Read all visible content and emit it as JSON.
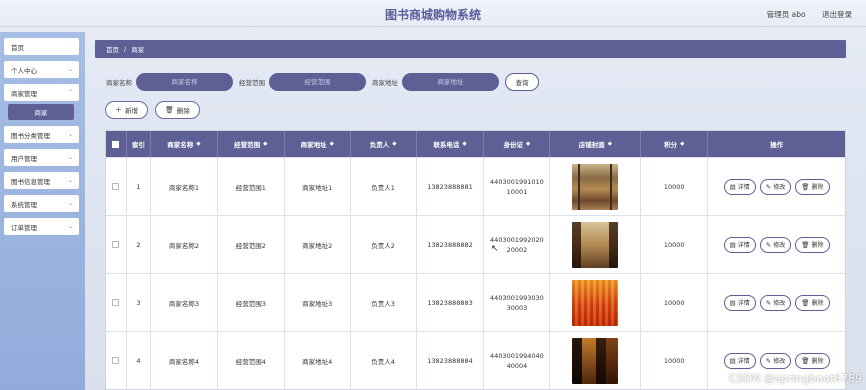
{
  "header": {
    "title": "图书商城购物系统",
    "user_label": "管理员 abo",
    "logout_label": "退出登录"
  },
  "sidebar": {
    "items": [
      {
        "label": "首页",
        "has_chevron": false
      },
      {
        "label": "个人中心",
        "has_chevron": true
      },
      {
        "label": "商家管理",
        "has_chevron": true
      },
      {
        "label": "图书分类管理",
        "has_chevron": true
      },
      {
        "label": "用户管理",
        "has_chevron": true
      },
      {
        "label": "图书信息管理",
        "has_chevron": true
      },
      {
        "label": "系统管理",
        "has_chevron": true
      },
      {
        "label": "订单管理",
        "has_chevron": true
      }
    ],
    "active_sub": "商家"
  },
  "breadcrumb": {
    "home": "首页",
    "separator": "/",
    "current": "商家"
  },
  "search": {
    "name_label": "商家名称",
    "name_placeholder": "商家名称",
    "scope_label": "经营范围",
    "scope_placeholder": "经营范围",
    "address_label": "商家地址",
    "address_placeholder": "商家地址",
    "button": "查询"
  },
  "toolbar": {
    "add": "新增",
    "delete": "删除"
  },
  "table": {
    "headers": {
      "index": "索引",
      "name": "商家名称",
      "scope": "经营范围",
      "address": "商家地址",
      "owner": "负责人",
      "phone": "联系电话",
      "idcard": "身份证",
      "image": "店铺封面",
      "points": "积分",
      "ops": "操作"
    },
    "rows": [
      {
        "index": "1",
        "name": "商家名称1",
        "scope": "经营范围1",
        "address": "商家地址1",
        "owner": "负责人1",
        "phone": "13823888881",
        "idcard": "440300199101010001",
        "points": "10000"
      },
      {
        "index": "2",
        "name": "商家名称2",
        "scope": "经营范围2",
        "address": "商家地址2",
        "owner": "负责人2",
        "phone": "13823888882",
        "idcard": "440300199202020002",
        "points": "10000"
      },
      {
        "index": "3",
        "name": "商家名称3",
        "scope": "经营范围3",
        "address": "商家地址3",
        "owner": "负责人3",
        "phone": "13823888883",
        "idcard": "440300199303030003",
        "points": "10000"
      },
      {
        "index": "4",
        "name": "商家名称4",
        "scope": "经营范围4",
        "address": "商家地址4",
        "owner": "负责人4",
        "phone": "13823888884",
        "idcard": "440300199404040004",
        "points": "10000"
      }
    ],
    "ops": {
      "detail": "详情",
      "edit": "修改",
      "delete": "删除"
    }
  },
  "watermark": "CSDN @springboot6789",
  "colors": {
    "primary": "#5d5f95",
    "sidebar": "#a7bde3",
    "title": "#5a5b9a"
  }
}
